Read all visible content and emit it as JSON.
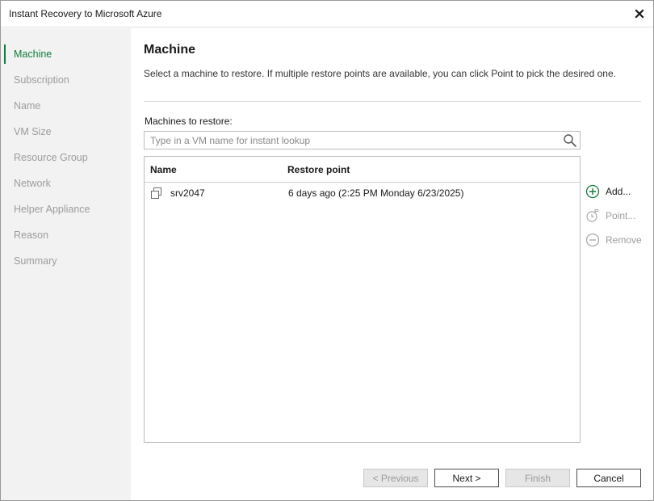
{
  "window": {
    "title": "Instant Recovery to Microsoft Azure"
  },
  "sidebar": {
    "steps": [
      {
        "label": "Machine",
        "active": true
      },
      {
        "label": "Subscription",
        "active": false
      },
      {
        "label": "Name",
        "active": false
      },
      {
        "label": "VM Size",
        "active": false
      },
      {
        "label": "Resource Group",
        "active": false
      },
      {
        "label": "Network",
        "active": false
      },
      {
        "label": "Helper Appliance",
        "active": false
      },
      {
        "label": "Reason",
        "active": false
      },
      {
        "label": "Summary",
        "active": false
      }
    ]
  },
  "main": {
    "heading": "Machine",
    "description": "Select a machine to restore. If multiple restore points are available, you can click Point to pick the desired one.",
    "list_label": "Machines to restore:",
    "search": {
      "placeholder": "Type in a VM name for instant lookup",
      "value": ""
    },
    "table": {
      "columns": [
        "Name",
        "Restore point"
      ],
      "rows": [
        {
          "name": "srv2047",
          "restore_point": "6 days ago (2:25 PM Monday 6/23/2025)"
        }
      ]
    },
    "actions": {
      "add": "Add...",
      "point": "Point...",
      "remove": "Remove"
    }
  },
  "footer": {
    "previous": "< Previous",
    "next": "Next >",
    "finish": "Finish",
    "cancel": "Cancel"
  },
  "colors": {
    "accent": "#0e7c3a",
    "sidebar_bg": "#f2f2f2",
    "disabled_text": "#9c9c9c"
  }
}
